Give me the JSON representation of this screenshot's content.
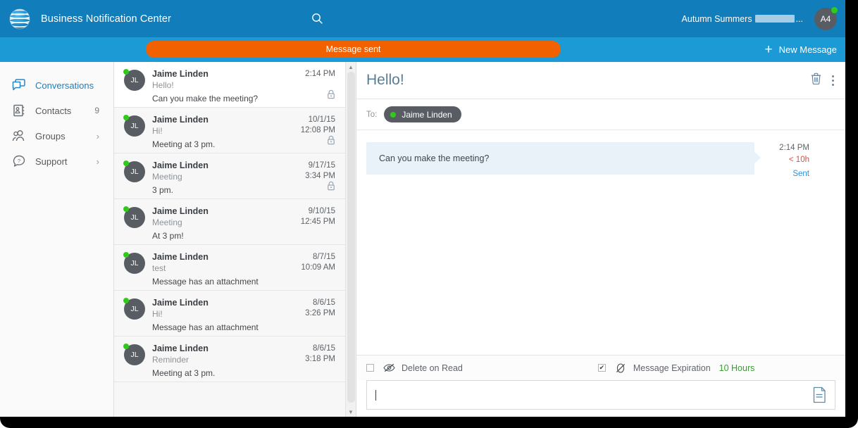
{
  "header": {
    "app_title": "Business Notification Center",
    "logo": "att-globe-logo",
    "search_icon": "search-icon",
    "user_name": "Autumn Summers",
    "user_name_suffix": "...",
    "avatar_initials": "A4",
    "avatar_status": "online"
  },
  "subbar": {
    "toast_message": "Message sent",
    "new_message_label": "New Message",
    "plus": "+"
  },
  "sidebar": {
    "items": [
      {
        "label": "Conversations",
        "icon": "conversations-icon",
        "badge": "",
        "chevron": "",
        "active": true
      },
      {
        "label": "Contacts",
        "icon": "contacts-icon",
        "badge": "9",
        "chevron": "",
        "active": false
      },
      {
        "label": "Groups",
        "icon": "groups-icon",
        "badge": "",
        "chevron": "›",
        "active": false
      },
      {
        "label": "Support",
        "icon": "support-icon",
        "badge": "",
        "chevron": "›",
        "active": false
      }
    ]
  },
  "conversations": [
    {
      "initials": "JL",
      "name": "Jaime Linden",
      "subject": "Hello!",
      "preview": "Can you make the meeting?",
      "date": "",
      "time": "2:14 PM",
      "locked": true,
      "selected": true
    },
    {
      "initials": "JL",
      "name": "Jaime Linden",
      "subject": "Hi!",
      "preview": "Meeting at 3 pm.",
      "date": "10/1/15",
      "time": "12:08 PM",
      "locked": true,
      "selected": false
    },
    {
      "initials": "JL",
      "name": "Jaime Linden",
      "subject": "Meeting",
      "preview": "3 pm.",
      "date": "9/17/15",
      "time": "3:34 PM",
      "locked": true,
      "selected": false
    },
    {
      "initials": "JL",
      "name": "Jaime Linden",
      "subject": "Meeting",
      "preview": "At 3 pm!",
      "date": "9/10/15",
      "time": "12:45 PM",
      "locked": false,
      "selected": false
    },
    {
      "initials": "JL",
      "name": "Jaime Linden",
      "subject": "test",
      "preview": "Message has an attachment",
      "date": "8/7/15",
      "time": "10:09 AM",
      "locked": false,
      "selected": false
    },
    {
      "initials": "JL",
      "name": "Jaime Linden",
      "subject": "Hi!",
      "preview": "Message has an attachment",
      "date": "8/6/15",
      "time": "3:26 PM",
      "locked": false,
      "selected": false
    },
    {
      "initials": "JL",
      "name": "Jaime Linden",
      "subject": "Reminder",
      "preview": "Meeting at 3 pm.",
      "date": "8/6/15",
      "time": "3:18 PM",
      "locked": false,
      "selected": false
    }
  ],
  "detail": {
    "title": "Hello!",
    "delete_icon": "trash-icon",
    "menu_icon": "kebab-menu-icon",
    "to_label": "To:",
    "recipient": "Jaime Linden",
    "message": {
      "text": "Can you make the meeting?",
      "time": "2:14 PM",
      "expiry": "< 10h",
      "status": "Sent"
    }
  },
  "options": {
    "delete_on_read_label": "Delete on Read",
    "delete_on_read_checked": false,
    "delete_on_read_icon": "eye-slash-icon",
    "expiration_label": "Message Expiration",
    "expiration_checked": true,
    "expiration_icon": "clock-slash-icon",
    "expiration_value": "10 Hours"
  },
  "composer": {
    "value": "",
    "placeholder": "",
    "attach_icon": "document-attachment-icon"
  },
  "colors": {
    "header_blue": "#127dbb",
    "sub_blue": "#1b9ad6",
    "toast_orange": "#f26100",
    "accent_blue": "#1a7fc1",
    "status_green": "#2ecc17",
    "expiry_red": "#e8483a",
    "value_green": "#3d9b34"
  }
}
